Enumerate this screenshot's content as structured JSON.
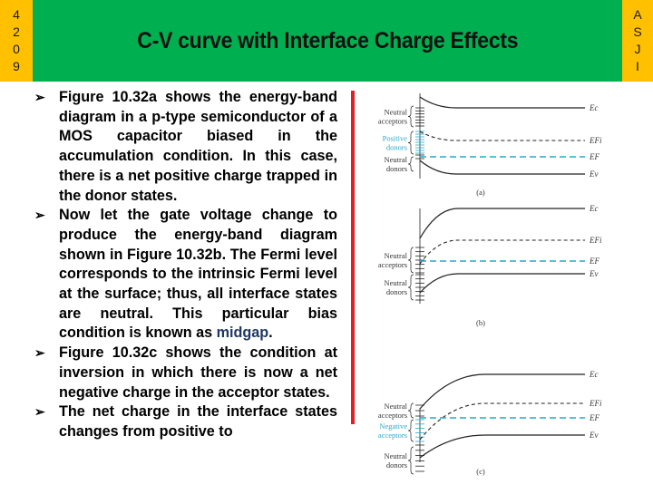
{
  "header": {
    "title": "C-V curve with Interface Charge Effects",
    "left_code": [
      "4",
      "2",
      "0",
      "9"
    ],
    "right_code": [
      "A",
      "S",
      "J",
      "I"
    ],
    "colors": {
      "banner": "#00B050",
      "strip": "#FFC000",
      "accent_bar": "#E31E24"
    }
  },
  "bullets": [
    {
      "icon": "arrow-bullet-icon",
      "text": "Figure 10.32a shows the energy-band diagram in a p-type semiconductor of a MOS capacitor biased in the accumulation condition. In this case, there is a net positive charge trapped in the donor states."
    },
    {
      "icon": "arrow-bullet-icon",
      "text_before": "Now let the gate voltage change to produce the energy-band diagram shown in Figure 10.32b. The Fermi level corresponds to the intrinsic Fermi level at the surface; thus, all interface states are neutral. This particular bias condition is known as ",
      "highlight": "midgap",
      "text_after": "."
    },
    {
      "icon": "arrow-bullet-icon",
      "text": "Figure 10.32c shows the condition at inversion in which there is now a net negative charge in the acceptor states."
    },
    {
      "icon": "arrow-bullet-icon",
      "text": "The net charge in the interface states changes from positive to"
    }
  ],
  "figure": {
    "panels": [
      {
        "caption": "(a)",
        "labels": [
          {
            "text": [
              "Neutral",
              "acceptors"
            ],
            "color": "dark"
          },
          {
            "text": [
              "Positive",
              "donors"
            ],
            "color": "cyan"
          },
          {
            "text": [
              "Neutral",
              "donors"
            ],
            "color": "dark"
          }
        ],
        "levels": [
          "Ec",
          "EFi",
          "EF",
          "Ev"
        ]
      },
      {
        "caption": "(b)",
        "labels": [
          {
            "text": [
              "Neutral",
              "acceptors"
            ],
            "color": "dark"
          },
          {
            "text": [
              "Neutral",
              "donors"
            ],
            "color": "dark"
          }
        ],
        "levels": [
          "Ec",
          "EFi",
          "EF",
          "Ev"
        ]
      },
      {
        "caption": "(c)",
        "labels": [
          {
            "text": [
              "Neutral",
              "acceptors"
            ],
            "color": "dark"
          },
          {
            "text": [
              "Negative",
              "acceptors"
            ],
            "color": "cyan"
          },
          {
            "text": [
              "Neutral",
              "donors"
            ],
            "color": "dark"
          }
        ],
        "levels": [
          "Ec",
          "EFi",
          "EF",
          "Ev"
        ]
      }
    ],
    "colors": {
      "line": "#222222",
      "fermi": "#29A9C7"
    }
  }
}
